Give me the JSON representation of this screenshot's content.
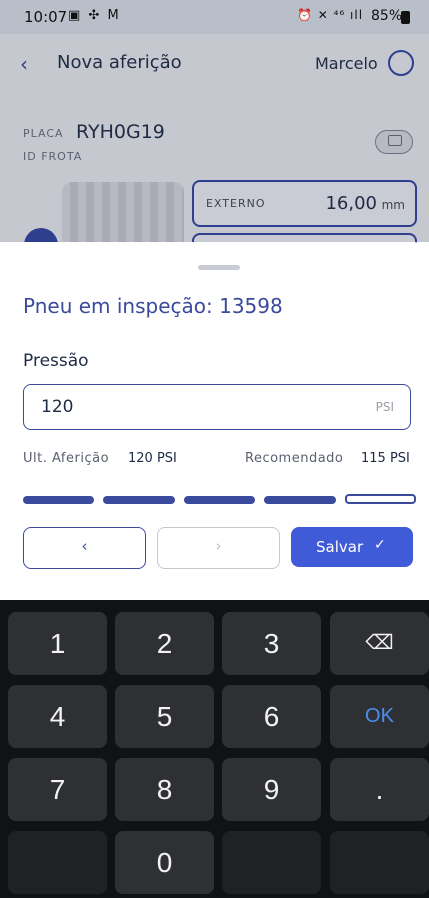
{
  "status_bar": {
    "time": "10:07",
    "left_icons": "▣ ✣ M",
    "right_icons": "⏰ ✕ ⁴⁶ ıll",
    "battery": "85%"
  },
  "header": {
    "back_icon": "‹",
    "title": "Nova aferição",
    "user_name": "Marcelo"
  },
  "vehicle": {
    "placa_label": "PLACA",
    "placa_value": "RYH0G19",
    "frota_label": "ID FROTA"
  },
  "measurement": {
    "externo_label": "EXTERNO",
    "externo_value": "16,00",
    "externo_unit": "mm"
  },
  "sheet": {
    "title": "Pneu em inspeção: 13598",
    "field_label": "Pressão",
    "pressure_value": "120",
    "pressure_unit": "PSI",
    "last_label": "Ult. Aferição",
    "last_value": "120 PSI",
    "recommended_label": "Recomendado",
    "recommended_value": "115 PSI",
    "steps_total": 5,
    "steps_current": 5,
    "prev_icon": "‹",
    "next_icon": "›",
    "save_label": "Salvar",
    "save_icon": "✓"
  },
  "keyboard": {
    "keys": [
      "1",
      "2",
      "3",
      "⌫",
      "4",
      "5",
      "6",
      "OK",
      "7",
      "8",
      "9",
      ".",
      "",
      "0",
      "",
      ""
    ]
  },
  "colors": {
    "accent": "#3a4a9c",
    "primary_button": "#3f5bd8",
    "ok_key": "#4a8ff0"
  }
}
